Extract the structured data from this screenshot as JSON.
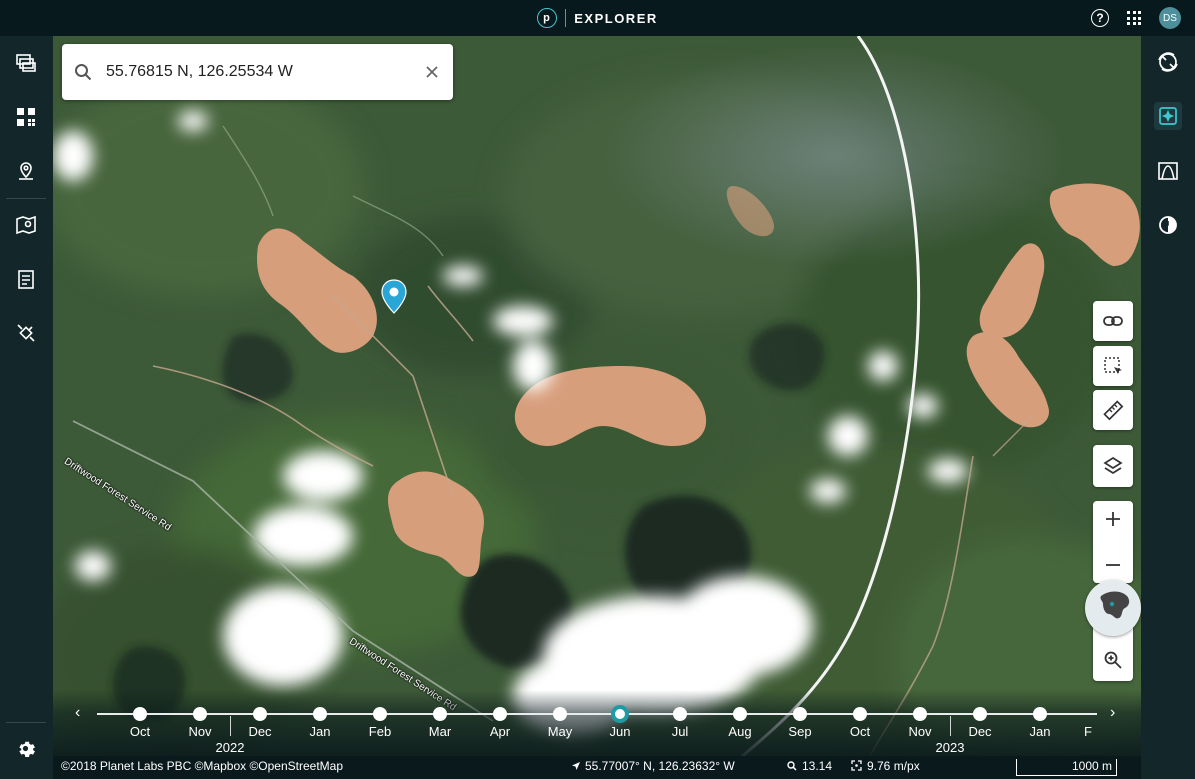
{
  "header": {
    "app_name": "EXPLORER",
    "logo_letter": "p",
    "user_initials": "DS"
  },
  "search": {
    "value": "55.76815 N, 126.25534 W",
    "placeholder": "Search"
  },
  "map": {
    "road_label_1": "Driftwood Forest Service Rd",
    "road_label_2": "Driftwood Forest Service Rd"
  },
  "timeline": {
    "months": [
      "Oct",
      "Nov",
      "Dec",
      "Jan",
      "Feb",
      "Mar",
      "Apr",
      "May",
      "Jun",
      "Jul",
      "Aug",
      "Sep",
      "Oct",
      "Nov",
      "Dec",
      "Jan",
      "F"
    ],
    "selected_index": 8,
    "years": [
      "2022",
      "2023"
    ]
  },
  "status": {
    "attribution": "©2018 Planet Labs PBC ©Mapbox ©OpenStreetMap",
    "cursor_coords": "55.77007° N, 126.23632° W",
    "zoom": "13.14",
    "resolution": "9.76 m/px",
    "scale": "1000 m"
  },
  "colors": {
    "accent": "#1f9ba6",
    "topbar": "#08191d",
    "sidebar": "#13272b"
  }
}
